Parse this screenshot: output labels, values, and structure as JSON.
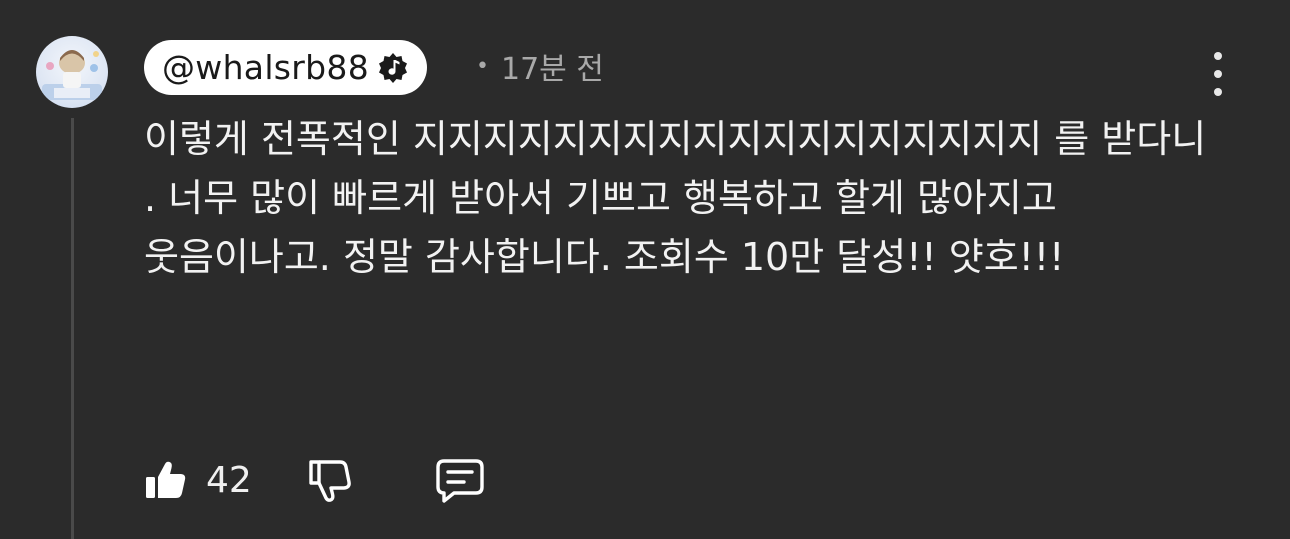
{
  "comment": {
    "author_handle": "@whalsrb88",
    "time_ago": "17분 전",
    "separator": "•",
    "text": "이렇게 전폭적인 지지지지지지지지지지지지지지지지지지 를 받다니 . 너무 많이 빠르게 받아서 기쁘고 행복하고 할게 많아지고 웃음이나고. 정말 감사합니다. 조회수 10만 달성!! 얏호!!!",
    "like_count": "42"
  },
  "icons": {
    "avatar": "profile-avatar-image",
    "verified": "music-note-badge-icon",
    "more": "vertical-ellipsis-icon",
    "like": "thumbs-up-filled-icon",
    "dislike": "thumbs-down-outline-icon",
    "reply": "comment-reply-icon"
  },
  "colors": {
    "background": "#2b2b2b",
    "text": "#f2f2f2",
    "muted": "#a9a9a9",
    "chip": "#ffffff"
  }
}
